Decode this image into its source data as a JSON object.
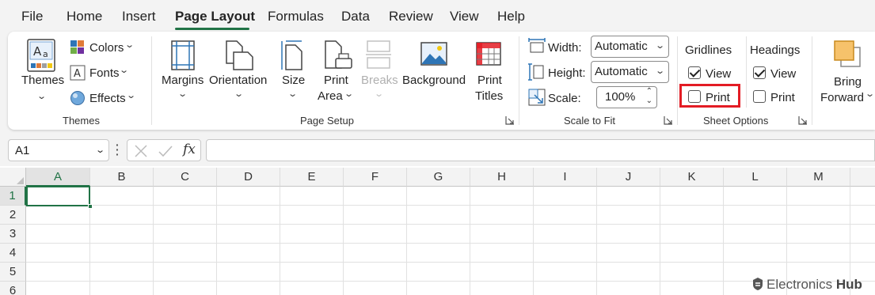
{
  "menu": {
    "items": [
      {
        "label": "File"
      },
      {
        "label": "Home"
      },
      {
        "label": "Insert"
      },
      {
        "label": "Page Layout"
      },
      {
        "label": "Formulas"
      },
      {
        "label": "Data"
      },
      {
        "label": "Review"
      },
      {
        "label": "View"
      },
      {
        "label": "Help"
      }
    ],
    "active": "Page Layout"
  },
  "ribbon": {
    "themes_group": {
      "themes_label": "Themes",
      "colors_label": "Colors",
      "fonts_label": "Fonts",
      "effects_label": "Effects",
      "group_label": "Themes"
    },
    "page_setup": {
      "margins_label": "Margins",
      "orientation_label": "Orientation",
      "size_label": "Size",
      "print_area_line1": "Print",
      "print_area_line2": "Area",
      "breaks_label": "Breaks",
      "background_label": "Background",
      "print_titles_line1": "Print",
      "print_titles_line2": "Titles",
      "group_label": "Page Setup"
    },
    "scale_to_fit": {
      "width_label": "Width:",
      "width_value": "Automatic",
      "height_label": "Height:",
      "height_value": "Automatic",
      "scale_label": "Scale:",
      "scale_value": "100%",
      "group_label": "Scale to Fit"
    },
    "sheet_options": {
      "gridlines_label": "Gridlines",
      "gridlines_view_label": "View",
      "gridlines_view_checked": true,
      "gridlines_print_label": "Print",
      "gridlines_print_checked": false,
      "headings_label": "Headings",
      "headings_view_label": "View",
      "headings_view_checked": true,
      "headings_print_label": "Print",
      "headings_print_checked": false,
      "group_label": "Sheet Options"
    },
    "arrange": {
      "bring_forward_line1": "Bring",
      "bring_forward_line2": "Forward"
    }
  },
  "formula_bar": {
    "name_box": "A1",
    "fx_label": "fx",
    "formula": ""
  },
  "grid": {
    "columns": [
      "A",
      "B",
      "C",
      "D",
      "E",
      "F",
      "G",
      "H",
      "I",
      "J",
      "K",
      "L",
      "M"
    ],
    "rows": [
      "1",
      "2",
      "3",
      "4",
      "5",
      "6"
    ],
    "selected_cell": "A1"
  },
  "watermark": {
    "brand_light": "Electronics",
    "brand_bold": "Hub"
  },
  "colors": {
    "accent": "#217346",
    "highlight": "#e31c24"
  }
}
